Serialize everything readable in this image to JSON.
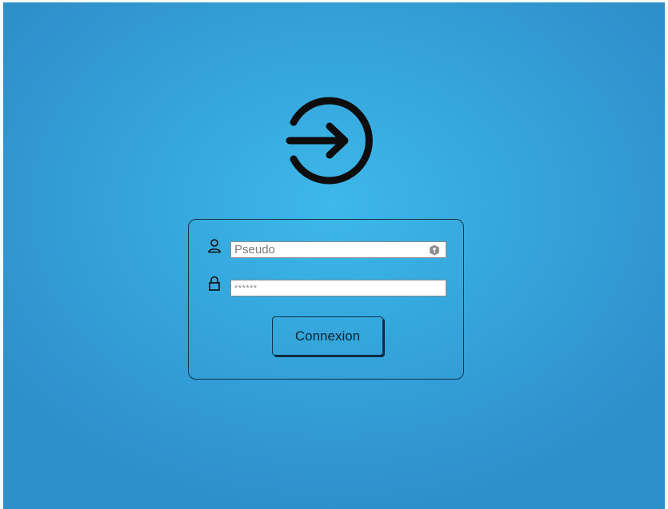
{
  "logo": {
    "icon": "sign-in-icon"
  },
  "login": {
    "username": {
      "icon": "user-icon",
      "placeholder": "Pseudo",
      "value": "",
      "autofill_icon": "key-badge-icon"
    },
    "password": {
      "icon": "lock-icon",
      "placeholder": "******",
      "value": ""
    },
    "submit_label": "Connexion"
  },
  "colors": {
    "background_center": "#3db8e8",
    "background_edge": "#2f8fcb",
    "border": "#10324a",
    "icon": "#0d0d0d"
  }
}
